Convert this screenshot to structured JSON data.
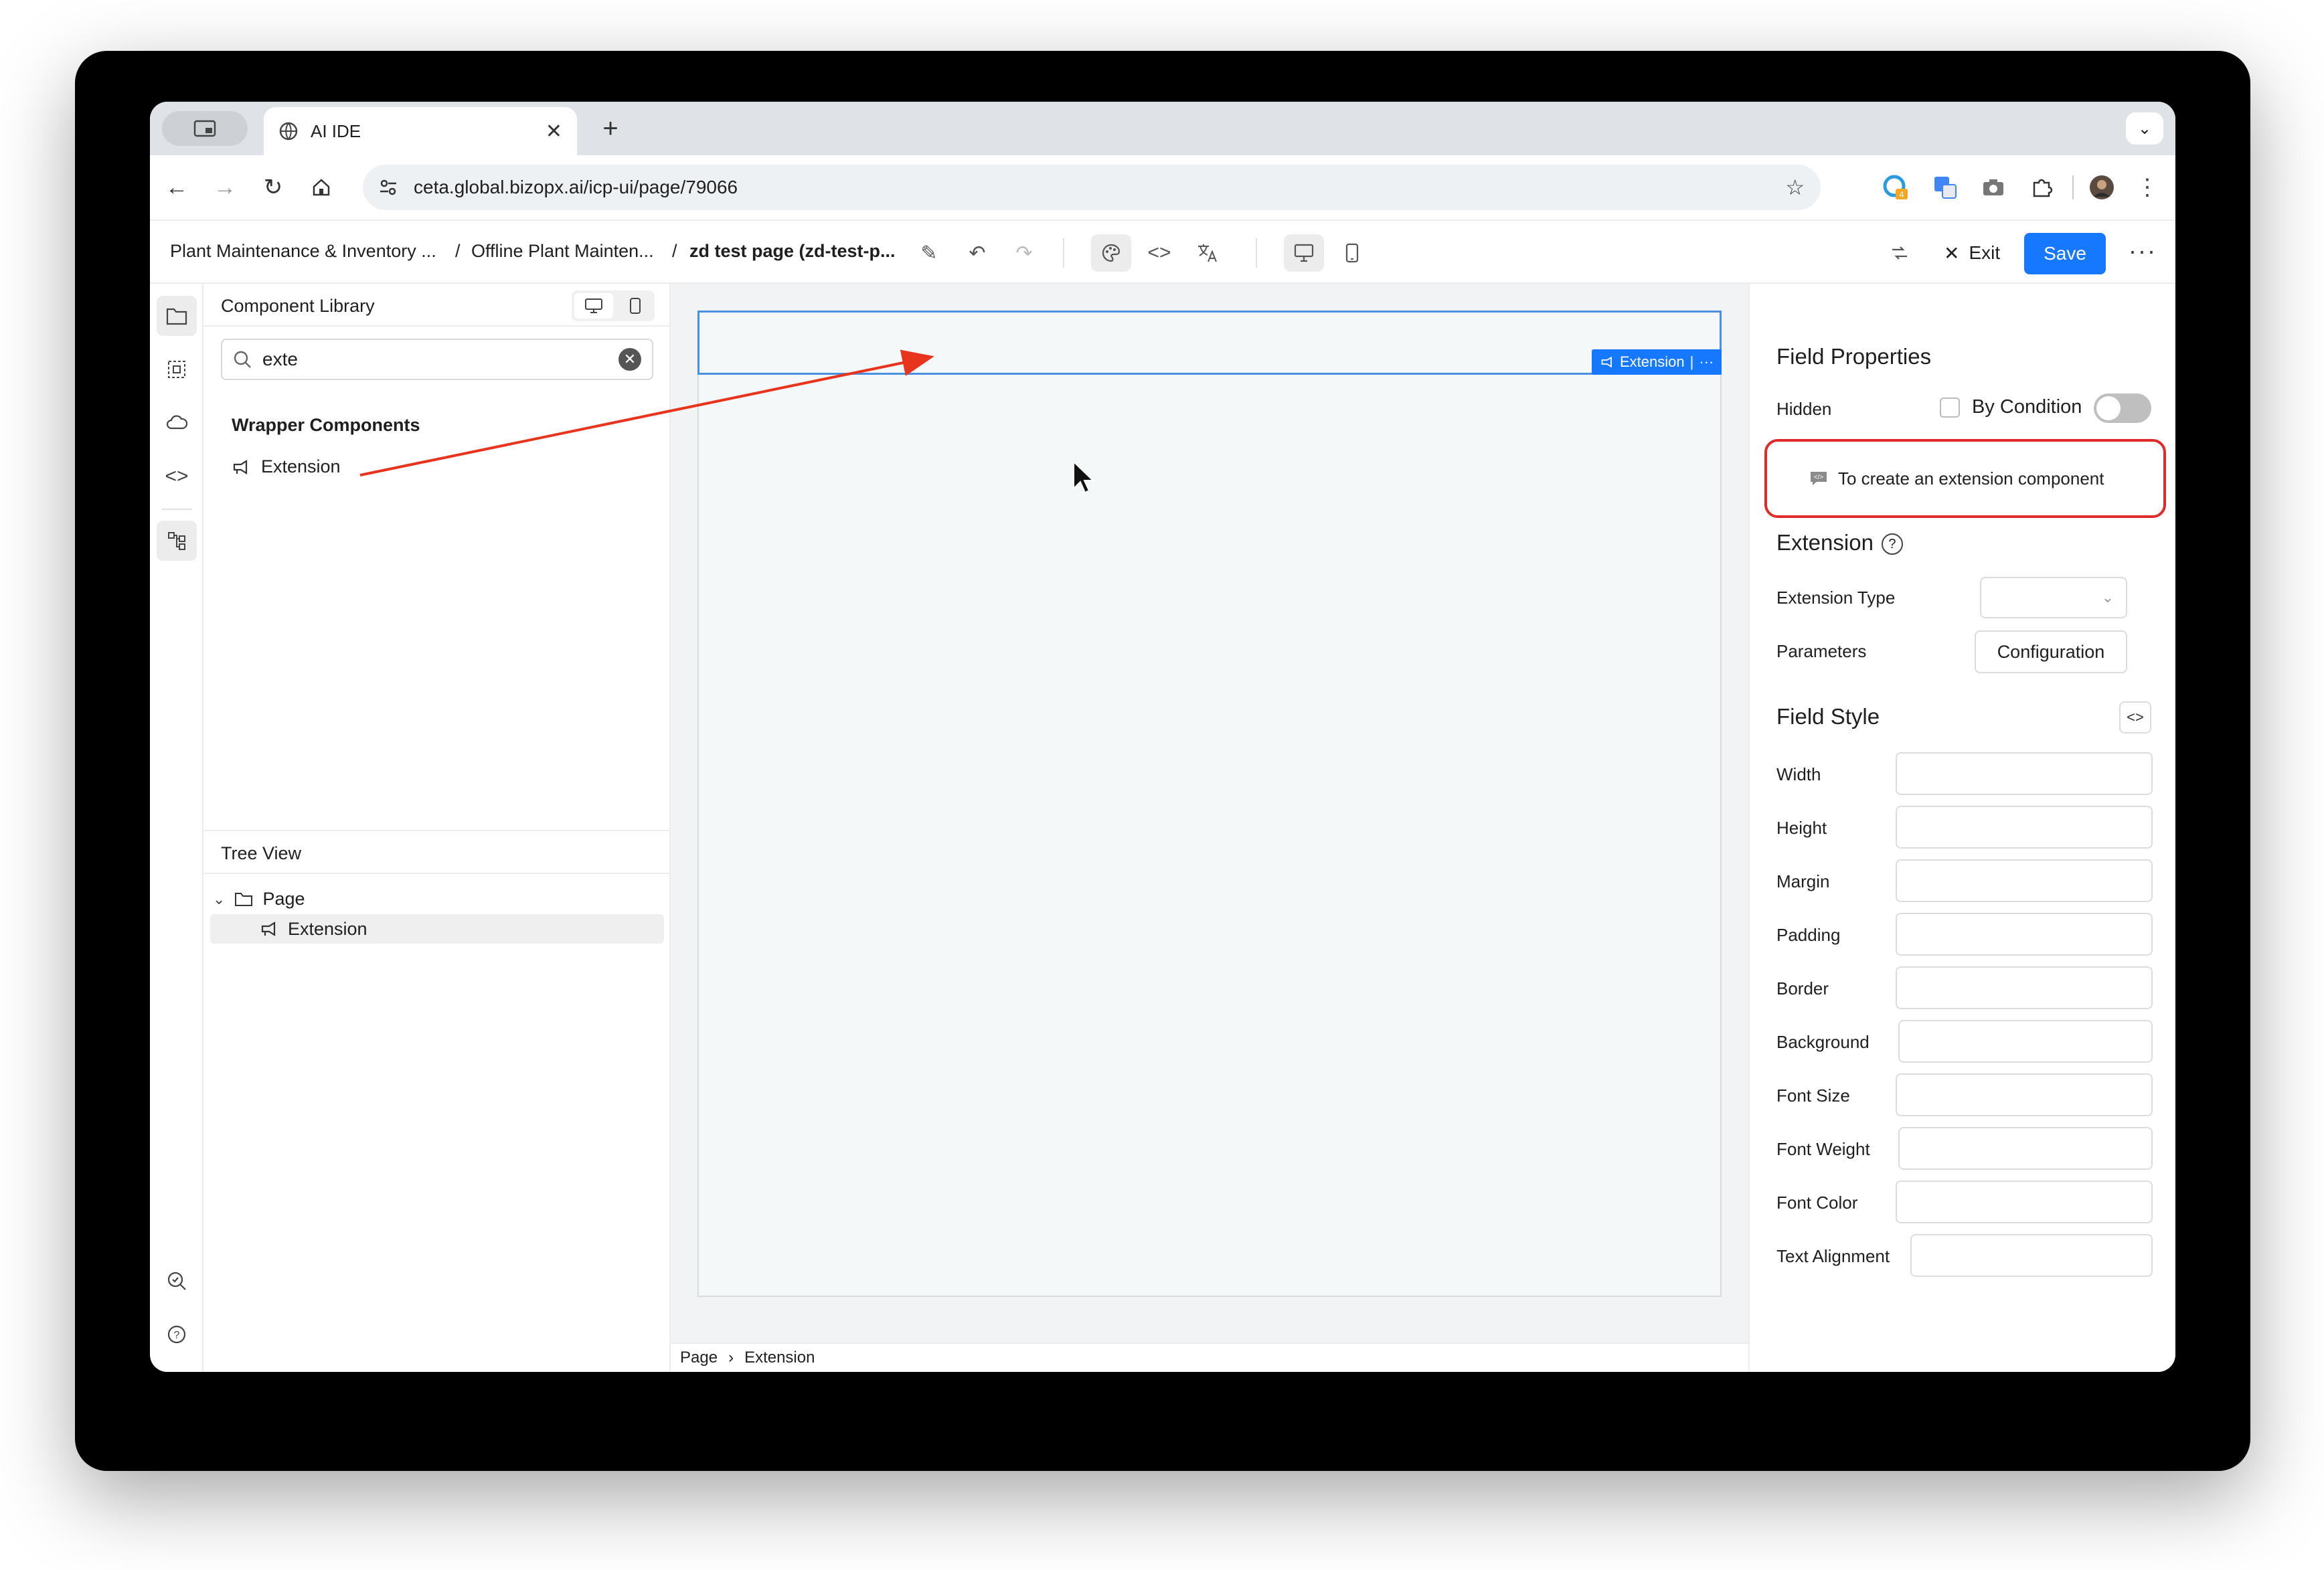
{
  "browser": {
    "tab_title": "AI IDE",
    "url": "ceta.global.bizopx.ai/icp-ui/page/79066",
    "extension_badge": "4"
  },
  "toolbar": {
    "breadcrumbs": [
      "Plant Maintenance & Inventory ...",
      "/",
      "Offline Plant Mainten...",
      "/",
      "zd test page (zd-test-p..."
    ],
    "exit_label": "Exit",
    "save_label": "Save"
  },
  "library": {
    "title": "Component Library",
    "search_value": "exte",
    "group_title": "Wrapper Components",
    "item_label": "Extension"
  },
  "tree": {
    "title": "Tree View",
    "root": "Page",
    "child": "Extension"
  },
  "canvas": {
    "selected_tag": "Extension",
    "footer_path": [
      "Page",
      "Extension"
    ]
  },
  "props": {
    "field_properties_title": "Field Properties",
    "hidden_label": "Hidden",
    "by_condition_label": "By Condition",
    "hint_text": "To create an extension component",
    "extension_title": "Extension",
    "extension_type_label": "Extension Type",
    "parameters_label": "Parameters",
    "configuration_label": "Configuration",
    "field_style_title": "Field Style",
    "style_fields": [
      "Width",
      "Height",
      "Margin",
      "Padding",
      "Border",
      "Background",
      "Font Size",
      "Font Weight",
      "Font Color",
      "Text Alignment"
    ]
  },
  "colors": {
    "accent": "#1677ff",
    "highlight": "#e12b2b",
    "selection_border": "#4a90e2"
  }
}
